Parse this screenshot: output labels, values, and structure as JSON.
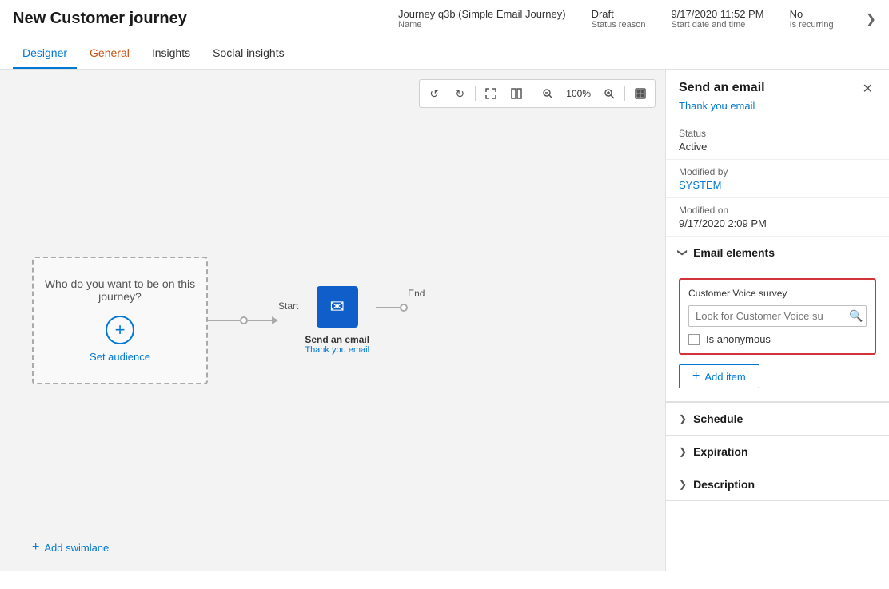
{
  "header": {
    "title": "New Customer journey",
    "meta": {
      "name_value": "Journey q3b (Simple Email Journey)",
      "name_label": "Name",
      "status_value": "Draft",
      "status_label": "Status reason",
      "date_value": "9/17/2020 11:52 PM",
      "date_label": "Start date and time",
      "recurring_value": "No",
      "recurring_label": "Is recurring"
    }
  },
  "tabs": [
    {
      "label": "Designer",
      "state": "active"
    },
    {
      "label": "General",
      "state": "orange"
    },
    {
      "label": "Insights",
      "state": "normal"
    },
    {
      "label": "Social insights",
      "state": "normal"
    }
  ],
  "canvas": {
    "swimlane_text": "Who do you want to be on this journey?",
    "set_audience_label": "Set audience",
    "start_label": "Start",
    "end_label": "End",
    "node_label": "Send an email",
    "node_sublabel": "Thank you email",
    "add_swimlane_label": "Add swimlane",
    "zoom_level": "100%"
  },
  "toolbar": {
    "undo": "↺",
    "redo": "↻",
    "expand": "⤢",
    "columns": "⊞",
    "zoom_out": "−",
    "zoom_in": "+",
    "fit": "⊡"
  },
  "panel": {
    "title": "Send an email",
    "subtitle": "Thank you email",
    "status_label": "Status",
    "status_value": "Active",
    "modified_by_label": "Modified by",
    "modified_by_value": "SYSTEM",
    "modified_on_label": "Modified on",
    "modified_on_value": "9/17/2020 2:09 PM",
    "email_elements_title": "Email elements",
    "cv_survey_label": "Customer Voice survey",
    "cv_search_placeholder": "Look for Customer Voice su",
    "cv_anonymous_label": "Is anonymous",
    "add_item_label": "Add item",
    "schedule_label": "Schedule",
    "expiration_label": "Expiration",
    "description_label": "Description"
  },
  "icons": {
    "close": "✕",
    "plus": "+",
    "chevron_down": "❯",
    "chevron_right": "❯",
    "search": "🔍",
    "email": "✉",
    "undo": "↺",
    "redo": "↻"
  },
  "colors": {
    "primary": "#0078d4",
    "active_tab": "#0078d4",
    "orange_tab": "#ca5010",
    "node_bg": "#0f5ec9",
    "border_red": "#d13438",
    "text_dark": "#1a1a1a",
    "text_medium": "#333",
    "text_light": "#666"
  }
}
